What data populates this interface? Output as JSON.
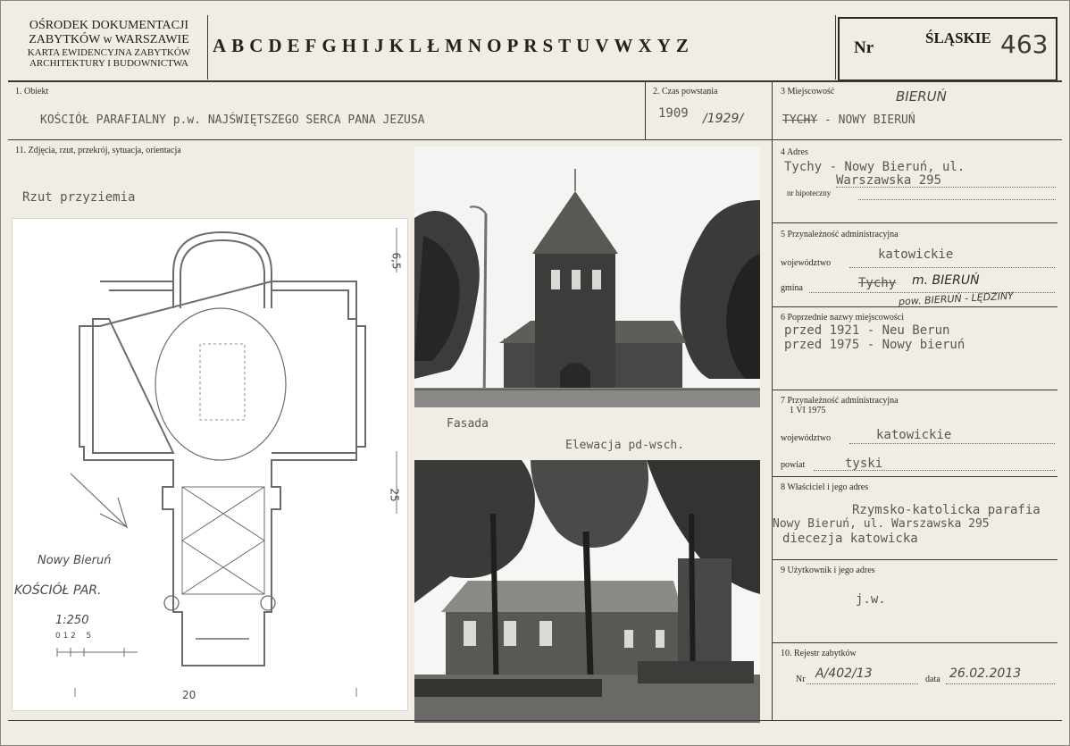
{
  "header": {
    "org_line1": "OŚRODEK DOKUMENTACJI",
    "org_line2": "ZABYTKÓW w WARSZAWIE",
    "org_line3": "KARTA EWIDENCYJNA ZABYTKÓW",
    "org_line4": "ARCHITEKTURY I BUDOWNICTWA",
    "letters": [
      "A",
      "B",
      "C",
      "D",
      "E",
      "F",
      "G",
      "H",
      "I",
      "J",
      "K",
      "L",
      "Ł",
      "M",
      "N",
      "O",
      "P",
      "R",
      "S",
      "T",
      "U",
      "V",
      "W",
      "X",
      "Y",
      "Z"
    ],
    "nr_label": "Nr",
    "region": "ŚLĄSKIE",
    "number": "463"
  },
  "section1": {
    "label": "1. Obiekt",
    "value": "KOŚCIÓŁ PARAFIALNY p.w. NAJŚWIĘTSZEGO SERCA PANA JEZUSA"
  },
  "section2": {
    "label": "2. Czas powstania",
    "value": "1909",
    "value_hand": "/1929/"
  },
  "section3": {
    "label": "3 Miejscowość",
    "value_struck": "TYCHY",
    "value": " - NOWY BIERUŃ",
    "hand": "BIERUŃ"
  },
  "section11": {
    "label": "11. Zdjęcia, rzut, przekrój, sytuacja, orientacja"
  },
  "plan": {
    "title": "Rzut przyziemia",
    "dim_top": "6,5",
    "dim_right": "25",
    "dim_bottom": "20",
    "hand1": "Nowy Bieruń",
    "hand2": "KOŚCIÓŁ PAR.",
    "scale": "1:250",
    "scale_ticks": "0 1 2    5"
  },
  "photo1": {
    "caption1": "Fasada",
    "caption2": "Elewacja pd-wsch."
  },
  "section4": {
    "label": "4 Adres",
    "line1": "Tychy - Nowy Bieruń, ul.",
    "line2": "Warszawska 295",
    "sub": "nr hipoteczny"
  },
  "section5": {
    "label": "5 Przynależność administracyjna",
    "woj_label": "województwo",
    "woj_value": "katowickie",
    "gmina_label": "gmina",
    "gmina_struck": "Tychy",
    "gmina_hand": "m. BIERUŃ",
    "gmina_hand2": "pow. BIERUŃ - LĘDZINY"
  },
  "section6": {
    "label": "6 Poprzednie nazwy miejscowości",
    "line1": "przed 1921 - Neu Berun",
    "line2": "przed 1975 - Nowy bieruń"
  },
  "section7": {
    "label": "7 Przynależność administracyjna",
    "date": "1 VI 1975",
    "woj_label": "województwo",
    "woj_value": "katowickie",
    "pow_label": "powiat",
    "pow_value": "tyski"
  },
  "section8": {
    "label": "8 Właściciel i jego adres",
    "line1": "Rzymsko-katolicka parafia",
    "line2": "Nowy Bieruń, ul. Warszawska 295",
    "line3": "diecezja katowicka"
  },
  "section9": {
    "label": "9 Użytkownik i jego adres",
    "value": "j.w."
  },
  "section10": {
    "label": "10. Rejestr zabytków",
    "nr_label": "Nr",
    "nr_value": "A/402/13",
    "date_label": "data",
    "date_value": "26.02.2013"
  }
}
